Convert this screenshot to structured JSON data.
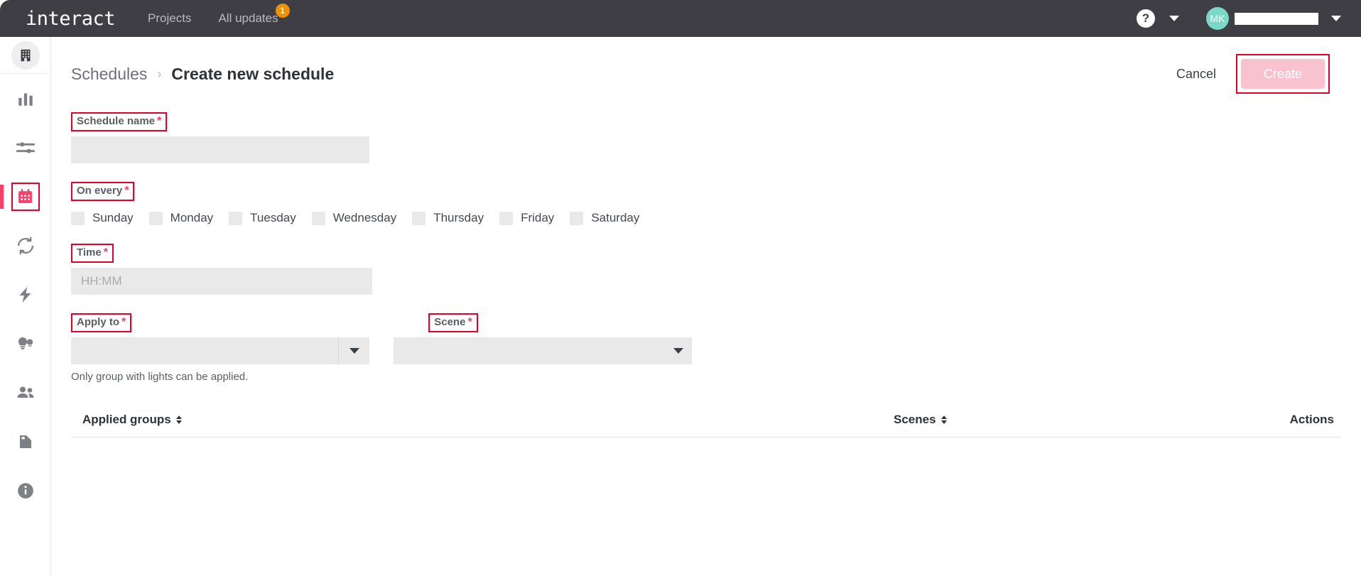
{
  "topbar": {
    "brand": "interact",
    "nav": [
      {
        "label": "Projects",
        "badge": ""
      },
      {
        "label": "All updates",
        "badge": "1"
      }
    ],
    "help_glyph": "?",
    "avatar_initials": "MK",
    "username_redacted": ""
  },
  "sidebar": {
    "items": [
      {
        "name": "organization",
        "icon": "building-icon",
        "active": false
      },
      {
        "name": "insights",
        "icon": "bar-chart-icon",
        "active": false
      },
      {
        "name": "controls",
        "icon": "sliders-icon",
        "active": false
      },
      {
        "name": "schedules",
        "icon": "calendar-icon",
        "active": true
      },
      {
        "name": "sync",
        "icon": "refresh-icon",
        "active": false
      },
      {
        "name": "energy",
        "icon": "lightning-bolt-icon",
        "active": false
      },
      {
        "name": "lights",
        "icon": "lightbulb-icon",
        "active": false
      },
      {
        "name": "users",
        "icon": "people-icon",
        "active": false
      },
      {
        "name": "reports",
        "icon": "document-icon",
        "active": false
      },
      {
        "name": "about",
        "icon": "info-icon",
        "active": false
      }
    ]
  },
  "header": {
    "breadcrumb_parent": "Schedules",
    "breadcrumb_sep": "›",
    "breadcrumb_current": "Create new schedule",
    "cancel_label": "Cancel",
    "create_label": "Create"
  },
  "form": {
    "schedule_name": {
      "label": "Schedule name",
      "required_mark": "*",
      "value": "",
      "placeholder": ""
    },
    "on_every": {
      "label": "On every",
      "required_mark": "*",
      "days": [
        {
          "label": "Sunday",
          "checked": false
        },
        {
          "label": "Monday",
          "checked": false
        },
        {
          "label": "Tuesday",
          "checked": false
        },
        {
          "label": "Wednesday",
          "checked": false
        },
        {
          "label": "Thursday",
          "checked": false
        },
        {
          "label": "Friday",
          "checked": false
        },
        {
          "label": "Saturday",
          "checked": false
        }
      ]
    },
    "time": {
      "label": "Time",
      "required_mark": "*",
      "value": "",
      "placeholder": "HH:MM"
    },
    "apply_to": {
      "label": "Apply to",
      "required_mark": "*",
      "value": "",
      "helper_text": "Only group with lights can be applied."
    },
    "scene": {
      "label": "Scene",
      "required_mark": "*",
      "value": ""
    }
  },
  "table": {
    "columns": [
      {
        "label": "Applied groups",
        "sortable": true
      },
      {
        "label": "Scenes",
        "sortable": true
      },
      {
        "label": "Actions",
        "sortable": false
      }
    ],
    "rows": []
  },
  "colors": {
    "topbar_bg": "#3e3e44",
    "accent_pink": "#f5406a",
    "annotation_red": "#e4002b",
    "badge_orange": "#f29000",
    "avatar_teal": "#7ad8c6",
    "input_grey": "#e9e9e9",
    "create_disabled": "#f8c3ce"
  }
}
